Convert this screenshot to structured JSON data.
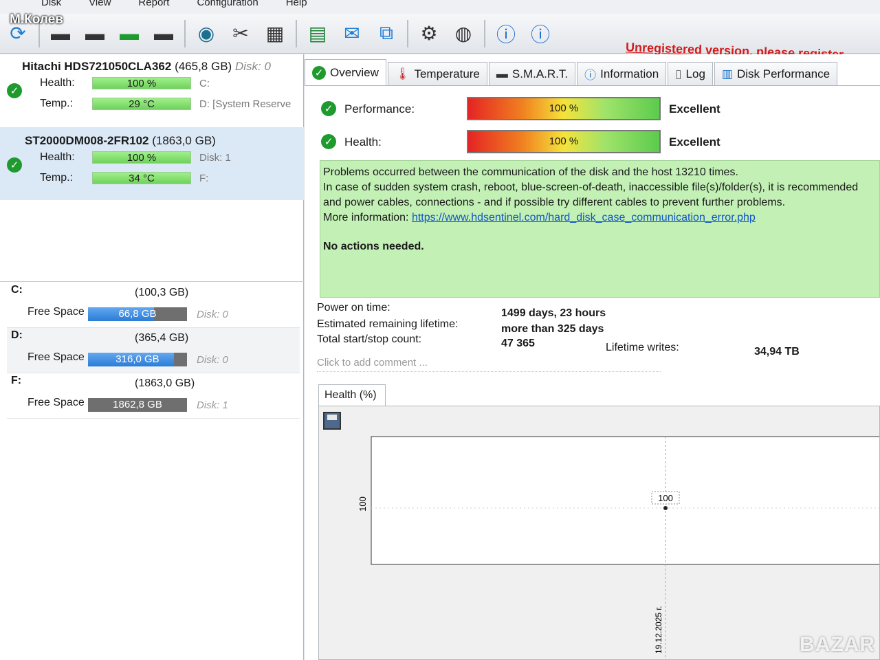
{
  "window": {
    "menu": [
      "Disk",
      "View",
      "Report",
      "Configuration",
      "Help"
    ],
    "user_watermark": "М.Колев",
    "unregistered": "Unregistered version, please register.",
    "toolbar_icons": [
      "refresh-icon",
      "hdd-icon",
      "hdd-icon",
      "hdd-icon",
      "hdd-icon",
      "globe-icon",
      "tools-icon",
      "printer-icon",
      "report-icon",
      "email-icon",
      "network-icon",
      "gear-icon",
      "alarm-icon",
      "help-icon",
      "info-icon"
    ],
    "watermark_site": "BAZAR"
  },
  "disks": [
    {
      "name": "Hitachi HDS721050CLA362",
      "capacity": "(465,8 GB)",
      "disk_label": "Disk: 0",
      "health_label": "Health:",
      "health": "100 %",
      "health_pct": 100,
      "temp_label": "Temp.:",
      "temp": "29 °C",
      "drive1": "C:",
      "drive2": "D:  [System Reserve"
    },
    {
      "name": "ST2000DM008-2FR102",
      "capacity": "(1863,0 GB)",
      "disk_label": "",
      "health_label": "Health:",
      "health": "100 %",
      "health_pct": 100,
      "temp_label": "Temp.:",
      "temp": "34 °C",
      "drive1": "Disk: 1",
      "drive2": "F:"
    }
  ],
  "volumes": [
    {
      "letter": "C:",
      "size": "(100,3 GB)",
      "free_label": "Free Space",
      "free": "66,8 GB",
      "free_frac": 0.666,
      "disk": "Disk: 0"
    },
    {
      "letter": "D:",
      "size": "(365,4 GB)",
      "free_label": "Free Space",
      "free": "316,0 GB",
      "free_frac": 0.865,
      "disk": "Disk: 0"
    },
    {
      "letter": "F:",
      "size": "(1863,0 GB)",
      "free_label": "Free Space",
      "free": "1862,8 GB",
      "free_frac": 0.9999,
      "disk": "Disk: 1"
    }
  ],
  "tabs": [
    {
      "label": "Overview",
      "icon": "ok-icon"
    },
    {
      "label": "Temperature",
      "icon": "thermometer-icon"
    },
    {
      "label": "S.M.A.R.T.",
      "icon": "smart-icon"
    },
    {
      "label": "Information",
      "icon": "info-icon"
    },
    {
      "label": "Log",
      "icon": "log-icon"
    },
    {
      "label": "Disk Performance",
      "icon": "performance-icon"
    }
  ],
  "overview": {
    "performance_label": "Performance:",
    "performance": "100 %",
    "performance_pct": 100,
    "performance_rating": "Excellent",
    "health_label": "Health:",
    "health": "100 %",
    "health_pct": 100,
    "health_rating": "Excellent",
    "message_lines": [
      "Problems occurred between the communication of the disk and the host 13210 times.",
      "In case of sudden system crash, reboot, blue-screen-of-death, inaccessible file(s)/folder(s), it is recommended",
      "and power cables, connections - and if possible try different cables to prevent further problems."
    ],
    "more_info_label": "More information:",
    "more_info_link": "https://www.hdsentinel.com/hard_disk_case_communication_error.php",
    "no_actions": "No actions needed.",
    "power_on_label": "Power on time:",
    "power_on": "1499 days, 23 hours",
    "lifetime_label": "Estimated remaining lifetime:",
    "lifetime": "more than 325 days",
    "startstop_label": "Total start/stop count:",
    "startstop": "47 365",
    "writes_label": "Lifetime writes:",
    "writes": "34,94 TB",
    "comment_placeholder": "Click to add comment ..."
  },
  "chart_data": {
    "type": "line",
    "title": "Health (%)",
    "ylabel": "100",
    "x": [
      "19.12.2025 г."
    ],
    "series": [
      {
        "values": [
          100
        ]
      }
    ],
    "point_label": "100"
  }
}
